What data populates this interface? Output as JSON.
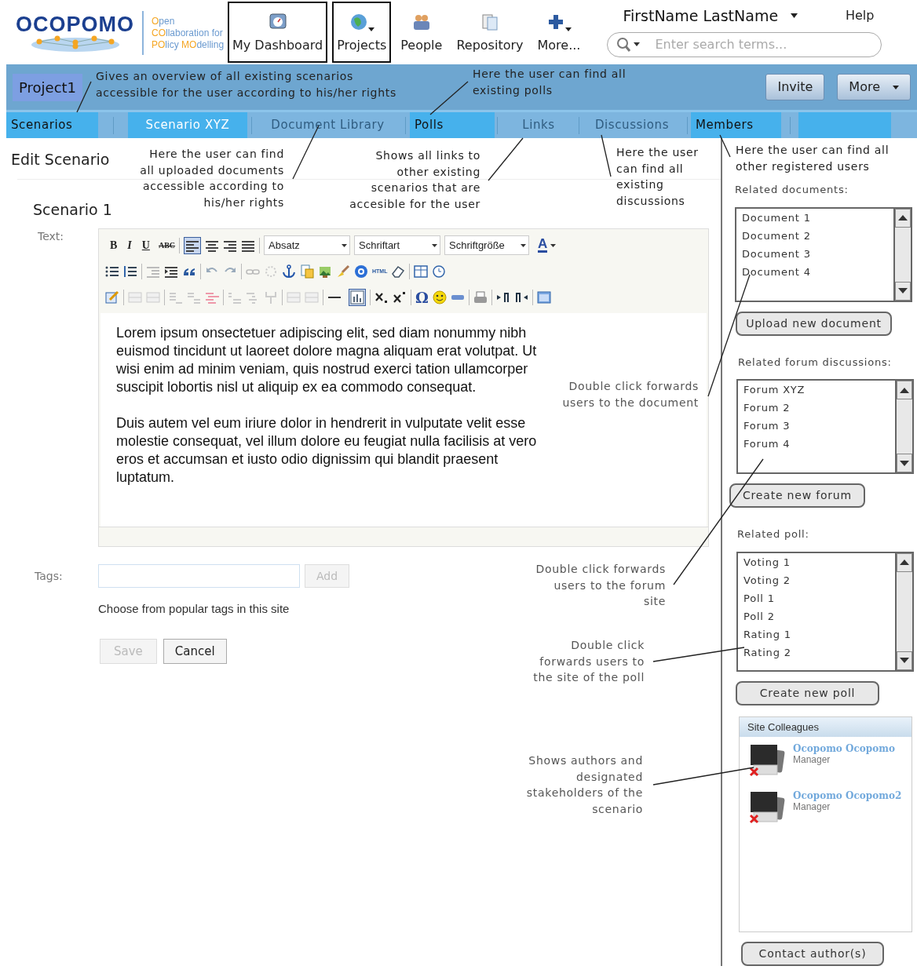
{
  "logo": {
    "name": "OCOPOMO",
    "tagline": [
      [
        {
          "text": "O",
          "accent": true
        },
        {
          "text": "pen",
          "accent": false
        }
      ],
      [
        {
          "text": "CO",
          "accent": true
        },
        {
          "text": "llaboration for",
          "accent": false
        }
      ],
      [
        {
          "text": "PO",
          "accent": true
        },
        {
          "text": "licy ",
          "accent": false
        },
        {
          "text": "MO",
          "accent": true
        },
        {
          "text": "delling",
          "accent": false
        }
      ]
    ]
  },
  "nav": [
    {
      "label": "My Dashboard",
      "outlined": true,
      "dropdown": false
    },
    {
      "label": "Projects",
      "outlined": true,
      "dropdown": true
    },
    {
      "label": "People",
      "outlined": false,
      "dropdown": false
    },
    {
      "label": "Repository",
      "outlined": false,
      "dropdown": false
    },
    {
      "label": "More...",
      "outlined": false,
      "dropdown": true
    }
  ],
  "user": {
    "name": "FirstName LastName"
  },
  "help": "Help",
  "search": {
    "placeholder": "Enter search terms..."
  },
  "project_bar": {
    "project": "Project1",
    "buttons": [
      {
        "label": "Invite",
        "dropdown": false
      },
      {
        "label": "More",
        "dropdown": true
      }
    ]
  },
  "tabs": [
    {
      "label": "Scenarios",
      "highlighted": true,
      "selected": false
    },
    {
      "label": "Scenario XYZ",
      "highlighted": true,
      "selected": true
    },
    {
      "label": "Document Library",
      "highlighted": false,
      "selected": false
    },
    {
      "label": "Polls",
      "highlighted": true,
      "selected": false
    },
    {
      "label": "Links",
      "highlighted": false,
      "selected": false
    },
    {
      "label": "Discussions",
      "highlighted": false,
      "selected": false
    },
    {
      "label": "Members",
      "highlighted": true,
      "selected": false
    }
  ],
  "annotations": [
    {
      "lines": [
        "Gives an overview of all existing scenarios",
        "accessible for the user according to his/her rights"
      ]
    },
    {
      "lines": [
        "Here the user can find all",
        "existing polls"
      ]
    },
    {
      "lines": [
        "Here the user can find",
        "all uploaded documents",
        "accessible according to",
        "his/her rights"
      ]
    },
    {
      "lines": [
        "Shows all links to",
        "other existing",
        "scenarios that are",
        "accesible for the user"
      ]
    },
    {
      "lines": [
        "Here the user",
        "can find all",
        "existing",
        "discussions"
      ]
    },
    {
      "lines": [
        "Here the user can find all",
        "other registered users"
      ]
    },
    {
      "lines": [
        "Double click forwards",
        "users to the document"
      ]
    },
    {
      "lines": [
        "Double click forwards",
        "users to the forum",
        "site"
      ]
    },
    {
      "lines": [
        "Double click",
        "forwards users to",
        "the site of the poll"
      ]
    },
    {
      "lines": [
        "Shows authors and",
        "designated",
        "stakeholders of the",
        "scenario"
      ]
    }
  ],
  "page": {
    "title": "Edit Scenario",
    "scenario": "Scenario 1",
    "text_label": "Text:"
  },
  "editor": {
    "labels": {
      "bold": "B",
      "italic": "I",
      "underline": "U",
      "strike": "ABC",
      "font_color": "A",
      "html": "HTML",
      "omega": "Ω"
    },
    "selects": [
      "Absatz",
      "Schriftart",
      "Schriftgröße"
    ],
    "paragraphs": [
      "Lorem ipsum onsectetuer adipiscing elit, sed diam nonummy nibh euismod tincidunt ut laoreet dolore magna aliquam erat volutpat. Ut wisi enim ad minim veniam, quis nostrud exerci tation ullamcorper suscipit lobortis nisl ut aliquip ex ea commodo consequat.",
      "Duis autem vel eum iriure dolor in hendrerit in vulputate velit esse molestie consequat, vel illum dolore eu feugiat nulla facilisis at vero eros et accumsan et iusto odio dignissim qui blandit praesent luptatum."
    ]
  },
  "tags": {
    "label": "Tags:",
    "add": {
      "label": "Add",
      "disabled": true
    },
    "hint": "Choose from popular tags in this site"
  },
  "actions": [
    {
      "label": "Save",
      "disabled": true
    },
    {
      "label": "Cancel",
      "disabled": false
    }
  ],
  "sidebar": {
    "sections": [
      {
        "title": "Related documents:",
        "items": [
          "Document 1",
          "Document 2",
          "Document 3",
          "Document 4"
        ],
        "button": "Upload new document"
      },
      {
        "title": "Related forum discussions:",
        "items": [
          "Forum XYZ",
          "Forum 2",
          "Forum 3",
          "Forum 4"
        ],
        "button": "Create new forum"
      },
      {
        "title": "Related poll:",
        "items": [
          "Voting 1",
          "Voting 2",
          "Poll 1",
          "Poll 2",
          "Rating 1",
          "Rating 2"
        ],
        "button": "Create new poll"
      }
    ],
    "colleagues": {
      "title": "Site Colleagues",
      "members": [
        {
          "name": "Ocopomo Ocopomo",
          "role": "Manager"
        },
        {
          "name": "Ocopomo Ocopomo2",
          "role": "Manager"
        }
      ]
    },
    "contact": "Contact author(s)"
  }
}
